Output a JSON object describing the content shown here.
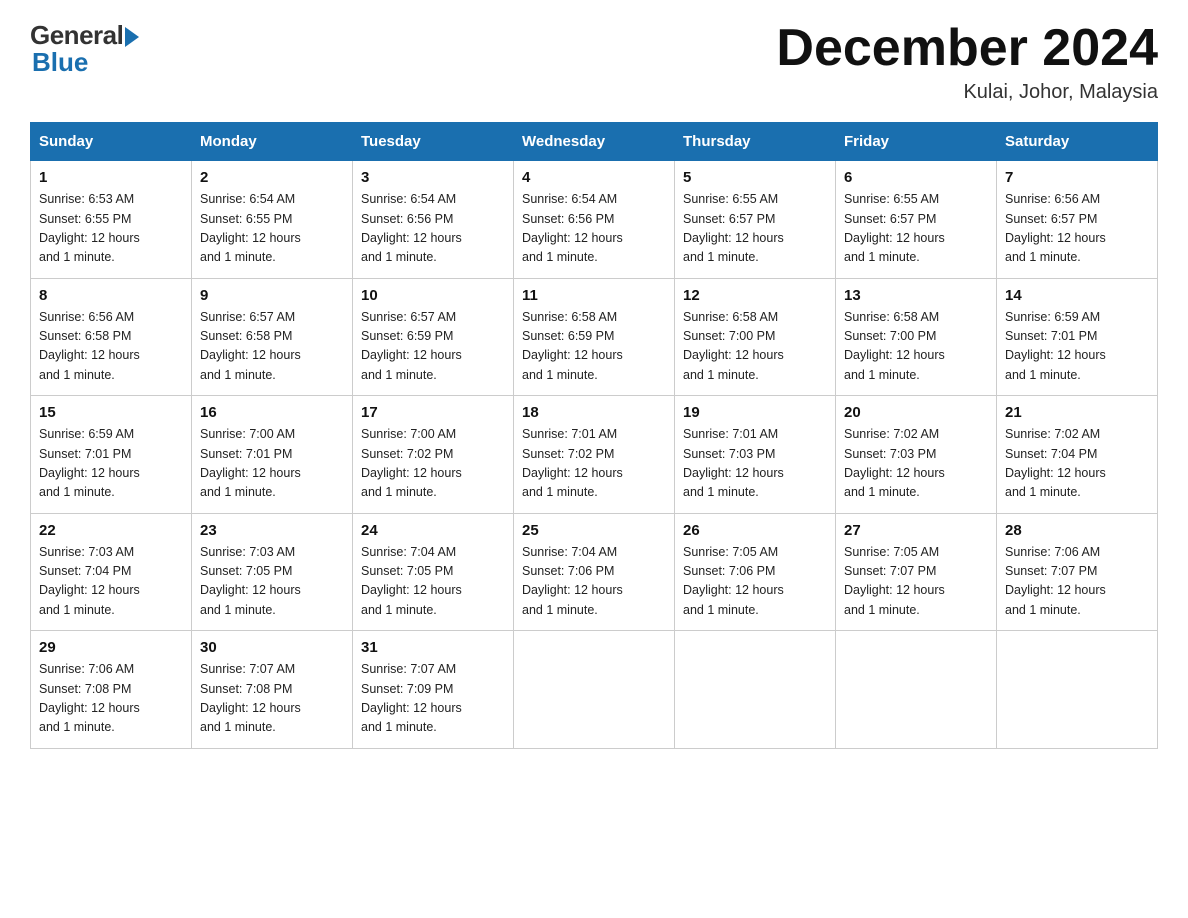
{
  "header": {
    "logo_general": "General",
    "logo_blue": "Blue",
    "month_title": "December 2024",
    "location": "Kulai, Johor, Malaysia"
  },
  "days_of_week": [
    "Sunday",
    "Monday",
    "Tuesday",
    "Wednesday",
    "Thursday",
    "Friday",
    "Saturday"
  ],
  "weeks": [
    [
      {
        "day": "1",
        "sunrise": "6:53 AM",
        "sunset": "6:55 PM",
        "daylight": "12 hours and 1 minute."
      },
      {
        "day": "2",
        "sunrise": "6:54 AM",
        "sunset": "6:55 PM",
        "daylight": "12 hours and 1 minute."
      },
      {
        "day": "3",
        "sunrise": "6:54 AM",
        "sunset": "6:56 PM",
        "daylight": "12 hours and 1 minute."
      },
      {
        "day": "4",
        "sunrise": "6:54 AM",
        "sunset": "6:56 PM",
        "daylight": "12 hours and 1 minute."
      },
      {
        "day": "5",
        "sunrise": "6:55 AM",
        "sunset": "6:57 PM",
        "daylight": "12 hours and 1 minute."
      },
      {
        "day": "6",
        "sunrise": "6:55 AM",
        "sunset": "6:57 PM",
        "daylight": "12 hours and 1 minute."
      },
      {
        "day": "7",
        "sunrise": "6:56 AM",
        "sunset": "6:57 PM",
        "daylight": "12 hours and 1 minute."
      }
    ],
    [
      {
        "day": "8",
        "sunrise": "6:56 AM",
        "sunset": "6:58 PM",
        "daylight": "12 hours and 1 minute."
      },
      {
        "day": "9",
        "sunrise": "6:57 AM",
        "sunset": "6:58 PM",
        "daylight": "12 hours and 1 minute."
      },
      {
        "day": "10",
        "sunrise": "6:57 AM",
        "sunset": "6:59 PM",
        "daylight": "12 hours and 1 minute."
      },
      {
        "day": "11",
        "sunrise": "6:58 AM",
        "sunset": "6:59 PM",
        "daylight": "12 hours and 1 minute."
      },
      {
        "day": "12",
        "sunrise": "6:58 AM",
        "sunset": "7:00 PM",
        "daylight": "12 hours and 1 minute."
      },
      {
        "day": "13",
        "sunrise": "6:58 AM",
        "sunset": "7:00 PM",
        "daylight": "12 hours and 1 minute."
      },
      {
        "day": "14",
        "sunrise": "6:59 AM",
        "sunset": "7:01 PM",
        "daylight": "12 hours and 1 minute."
      }
    ],
    [
      {
        "day": "15",
        "sunrise": "6:59 AM",
        "sunset": "7:01 PM",
        "daylight": "12 hours and 1 minute."
      },
      {
        "day": "16",
        "sunrise": "7:00 AM",
        "sunset": "7:01 PM",
        "daylight": "12 hours and 1 minute."
      },
      {
        "day": "17",
        "sunrise": "7:00 AM",
        "sunset": "7:02 PM",
        "daylight": "12 hours and 1 minute."
      },
      {
        "day": "18",
        "sunrise": "7:01 AM",
        "sunset": "7:02 PM",
        "daylight": "12 hours and 1 minute."
      },
      {
        "day": "19",
        "sunrise": "7:01 AM",
        "sunset": "7:03 PM",
        "daylight": "12 hours and 1 minute."
      },
      {
        "day": "20",
        "sunrise": "7:02 AM",
        "sunset": "7:03 PM",
        "daylight": "12 hours and 1 minute."
      },
      {
        "day": "21",
        "sunrise": "7:02 AM",
        "sunset": "7:04 PM",
        "daylight": "12 hours and 1 minute."
      }
    ],
    [
      {
        "day": "22",
        "sunrise": "7:03 AM",
        "sunset": "7:04 PM",
        "daylight": "12 hours and 1 minute."
      },
      {
        "day": "23",
        "sunrise": "7:03 AM",
        "sunset": "7:05 PM",
        "daylight": "12 hours and 1 minute."
      },
      {
        "day": "24",
        "sunrise": "7:04 AM",
        "sunset": "7:05 PM",
        "daylight": "12 hours and 1 minute."
      },
      {
        "day": "25",
        "sunrise": "7:04 AM",
        "sunset": "7:06 PM",
        "daylight": "12 hours and 1 minute."
      },
      {
        "day": "26",
        "sunrise": "7:05 AM",
        "sunset": "7:06 PM",
        "daylight": "12 hours and 1 minute."
      },
      {
        "day": "27",
        "sunrise": "7:05 AM",
        "sunset": "7:07 PM",
        "daylight": "12 hours and 1 minute."
      },
      {
        "day": "28",
        "sunrise": "7:06 AM",
        "sunset": "7:07 PM",
        "daylight": "12 hours and 1 minute."
      }
    ],
    [
      {
        "day": "29",
        "sunrise": "7:06 AM",
        "sunset": "7:08 PM",
        "daylight": "12 hours and 1 minute."
      },
      {
        "day": "30",
        "sunrise": "7:07 AM",
        "sunset": "7:08 PM",
        "daylight": "12 hours and 1 minute."
      },
      {
        "day": "31",
        "sunrise": "7:07 AM",
        "sunset": "7:09 PM",
        "daylight": "12 hours and 1 minute."
      },
      null,
      null,
      null,
      null
    ]
  ],
  "labels": {
    "sunrise_prefix": "Sunrise: ",
    "sunset_prefix": "Sunset: ",
    "daylight_prefix": "Daylight: "
  }
}
